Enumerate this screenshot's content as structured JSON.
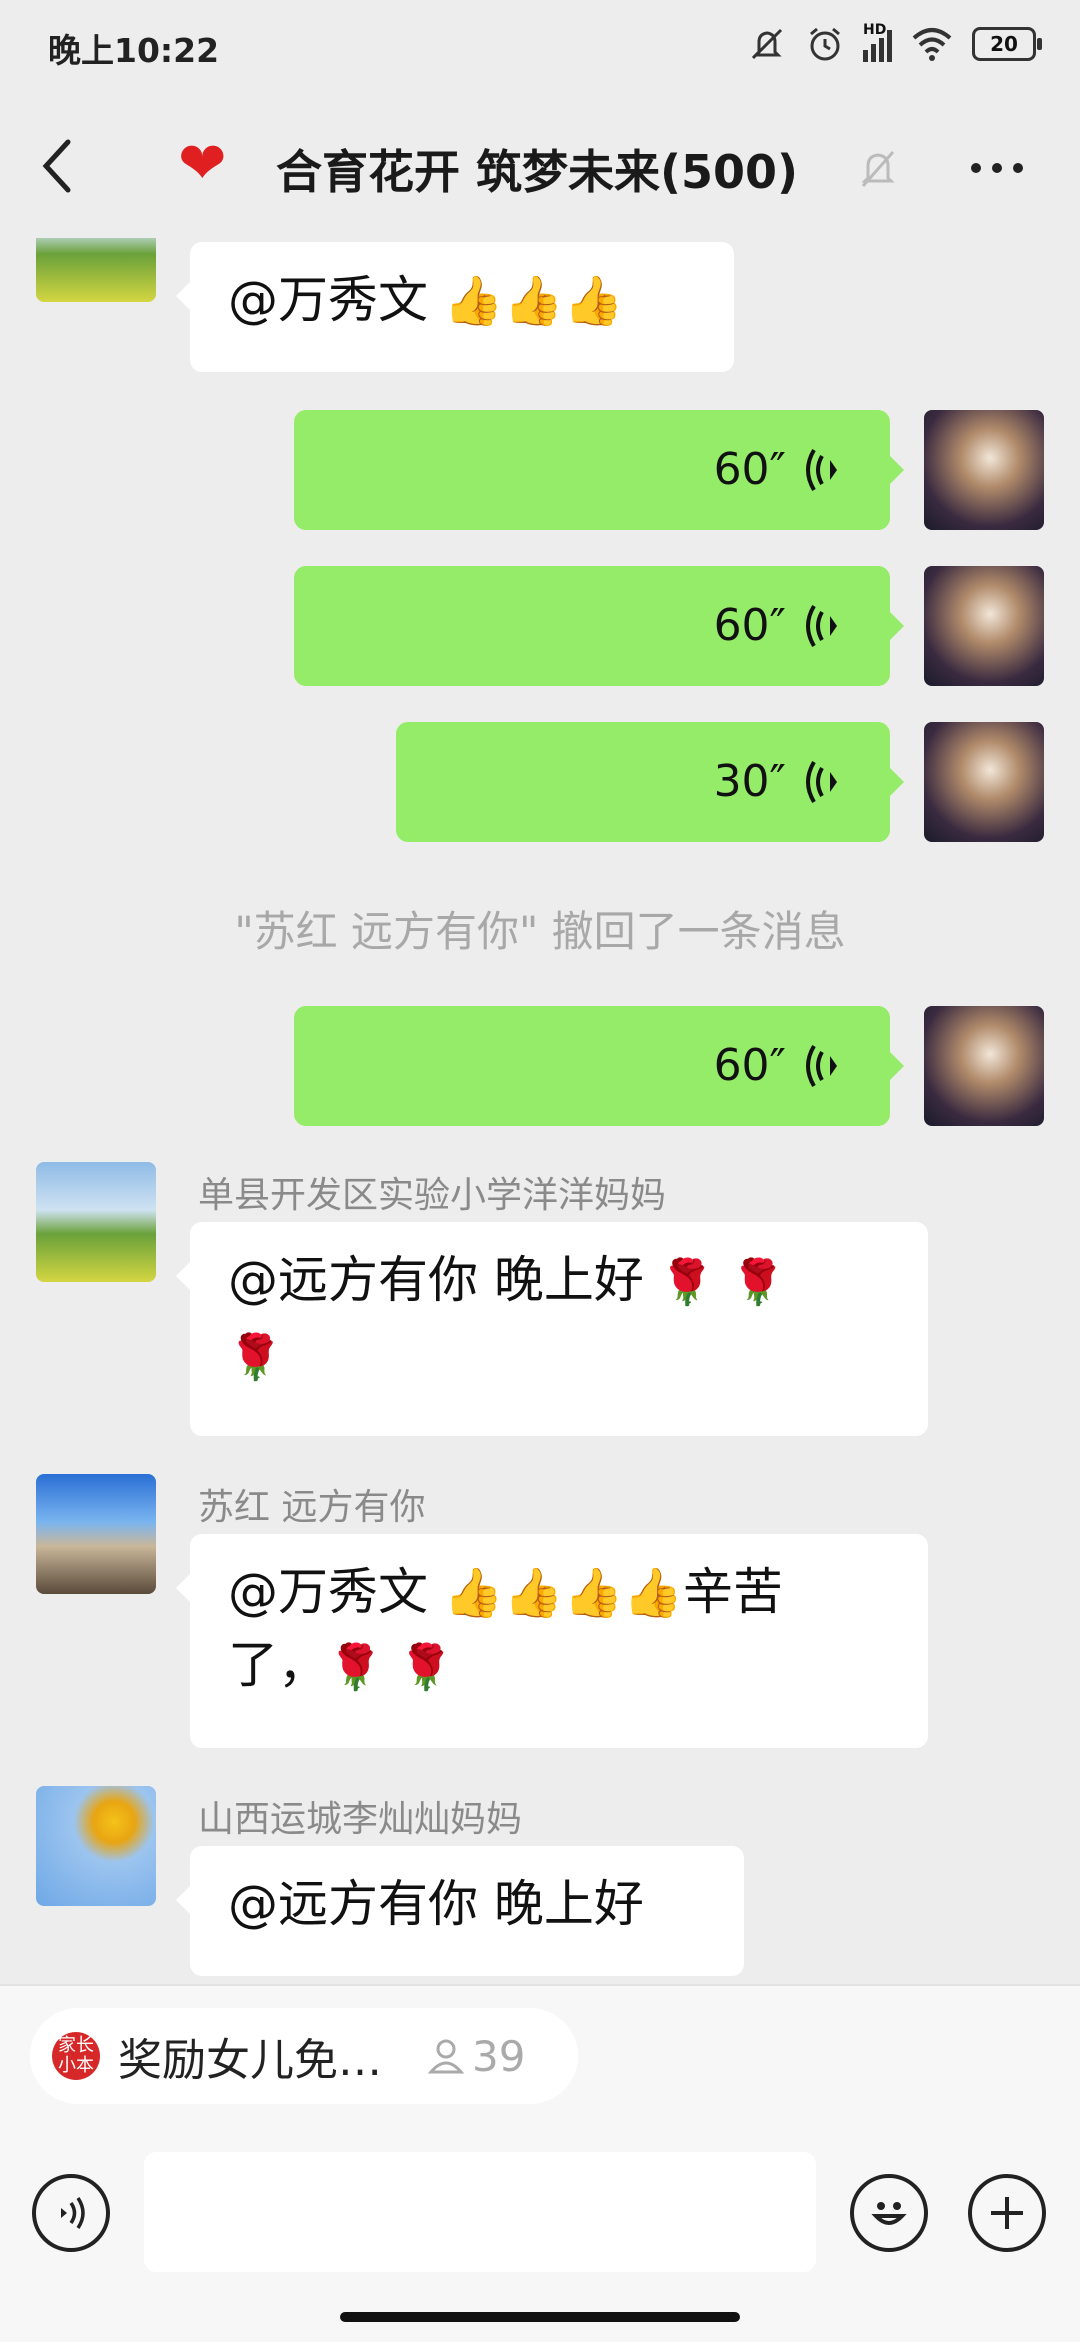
{
  "status_bar": {
    "time": "晚上10:22",
    "network_label": "HD",
    "battery": "20"
  },
  "header": {
    "title": "合育花开 筑梦未来(500)"
  },
  "messages": {
    "m1": {
      "text": "@万秀文 "
    },
    "v1": {
      "duration": "60″"
    },
    "v2": {
      "duration": "60″"
    },
    "v3": {
      "duration": "30″"
    },
    "system": {
      "text": "\"苏红 远方有你\" 撤回了一条消息"
    },
    "v4": {
      "duration": "60″"
    },
    "m2": {
      "sender": "单县开发区实验小学洋洋妈妈",
      "text": "@远方有你  晚上好"
    },
    "m3": {
      "sender": "苏红 远方有你",
      "text_a": "@万秀文 ",
      "text_b": "辛苦",
      "text_c": "了，"
    },
    "m4": {
      "sender": "山西运城李灿灿妈妈",
      "text": "@远方有你  晚上好"
    }
  },
  "bottom": {
    "pinned_title": "奖励女儿免…",
    "pinned_count": "39",
    "pinned_app_label": "家长小本",
    "input_value": ""
  },
  "colors": {
    "bubble_green": "#95ec69",
    "background": "#ededed",
    "accent_red": "#e02020"
  }
}
